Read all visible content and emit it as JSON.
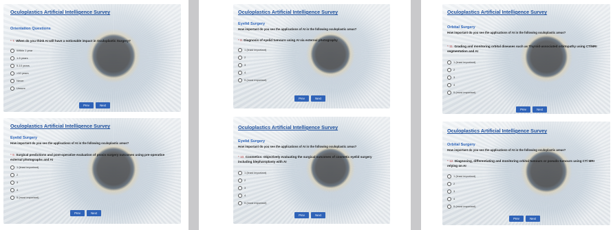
{
  "survey_title": "Oculoplastics Artificial Intelligence Survey",
  "nav": {
    "prev": "Prev",
    "next": "Next"
  },
  "panels": [
    {
      "section": "Orientation Questions",
      "subquestion": "",
      "question": "When do you think AI will have a noticeable impact in Oculoplastic Surgery?",
      "qnum": "* 7.",
      "options": [
        "Within 1 year",
        "1-5 years",
        "5-10 years",
        ">10 years",
        "Never",
        "Unsure"
      ]
    },
    {
      "section": "Eyelid Surgery",
      "subquestion": "How important do you see the applications of AI in the following oculoplastic areas?",
      "question": "Surgical predictions and post-operative evaluation of ptosis surgery outcomes using pre-operative external photographs and AI",
      "qnum": "* 9.",
      "options": [
        "1 (least important)",
        "2",
        "3",
        "4",
        "5 (most important)"
      ]
    },
    {
      "section": "Eyelid Surgery",
      "subquestion": "How important do you see the applications of AI in the following oculoplastic areas?",
      "question": "Diagnosis of eyelid tumours using AI via external photography",
      "qnum": "* 8.",
      "options": [
        "1 (least important)",
        "2",
        "3",
        "4",
        "5 (most important)"
      ]
    },
    {
      "section": "Eyelid Surgery",
      "subquestion": "How important do you see the applications of AI in the following oculoplastic areas?",
      "question": "Cosmetics: Objectively evaluating the surgical outcomes of cosmetic eyelid surgery including blepharoplasty with AI",
      "qnum": "* 10.",
      "options": [
        "1 (least important)",
        "2",
        "3",
        "4",
        "5 (most important)"
      ]
    },
    {
      "section": "Orbital Surgery",
      "subquestion": "How important do you see the applications of AI in the following oculoplastic areas?",
      "question": "Grading and monitoring orbital diseases such as Thyroid-associated orbitopathy using CT/MRI segmentation and AI",
      "qnum": "* 11.",
      "options": [
        "1 (least important)",
        "2",
        "3",
        "4",
        "5 (most important)"
      ]
    },
    {
      "section": "Orbital Surgery",
      "subquestion": "How important do you see the applications of AI in the following oculoplastic areas?",
      "question": "Diagnosing, differentiating and monitoring orbital tumours or pseudo-tumours using CT/ MRI relying on AI",
      "qnum": "* 12.",
      "options": [
        "1 (least important)",
        "2",
        "3",
        "4",
        "5 (most important)"
      ]
    }
  ]
}
